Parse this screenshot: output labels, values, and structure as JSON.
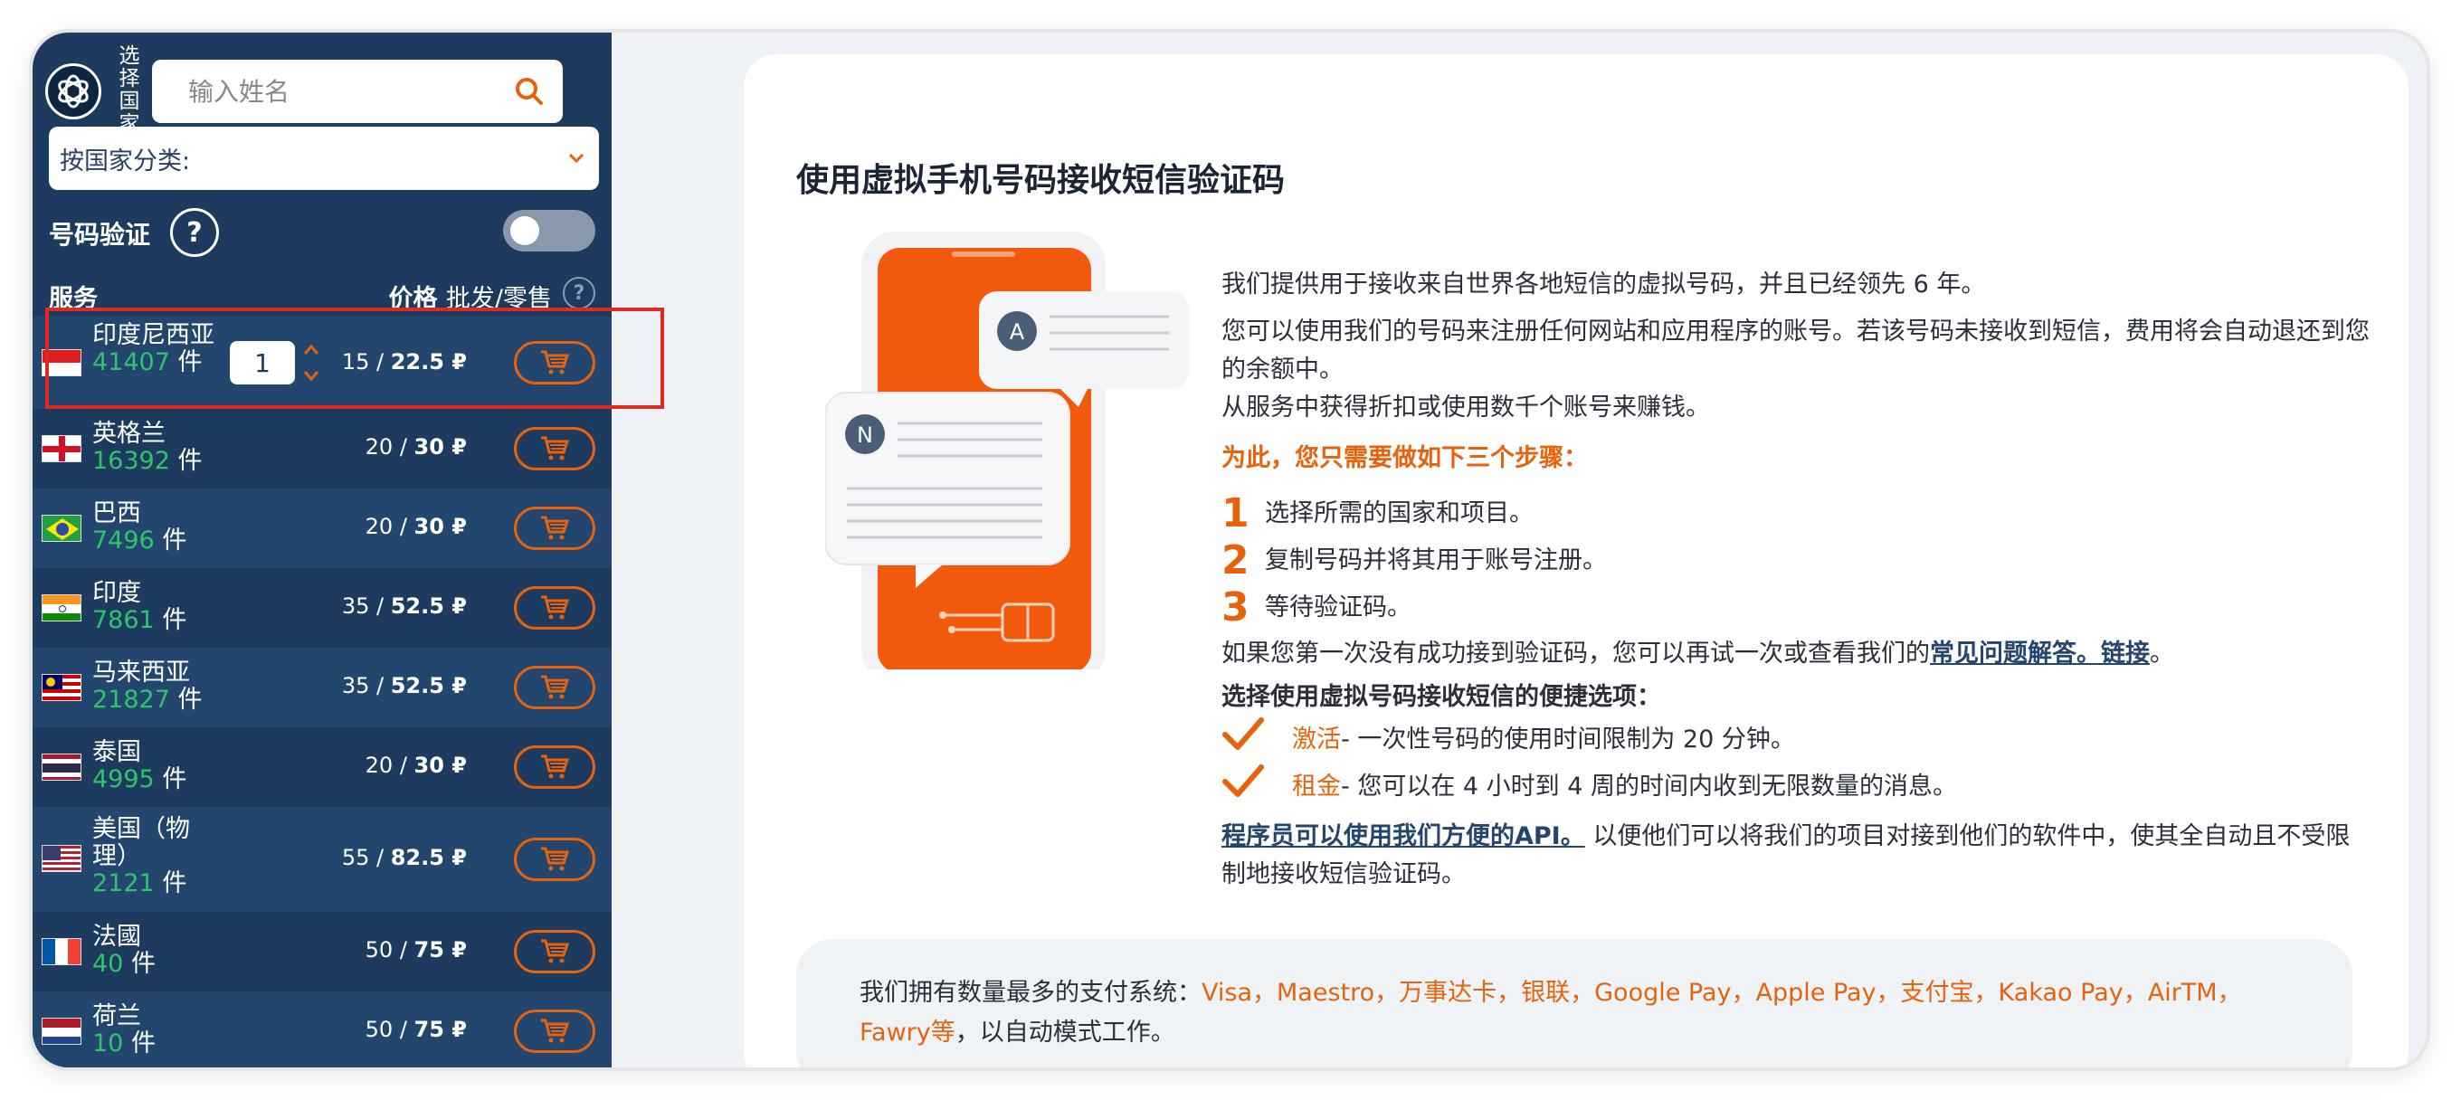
{
  "sidebar": {
    "vertical_label": "选择国家",
    "search_placeholder": "输入姓名",
    "country_filter": "按国家分类:",
    "verify_label": "号码验证",
    "help_label": "?",
    "col_service": "服务",
    "col_price": "价格",
    "col_price_sub": "批发/零售",
    "col_q": "?",
    "count_unit": "件",
    "rows": [
      {
        "name": "印度尼西亚",
        "count": "41407",
        "price": "15 / ",
        "price_bold": "22.5 ₽",
        "qty": "1"
      },
      {
        "name": "英格兰",
        "count": "16392",
        "price": "20 / ",
        "price_bold": "30 ₽"
      },
      {
        "name": "巴西",
        "count": "7496",
        "price": "20 / ",
        "price_bold": "30 ₽"
      },
      {
        "name": "印度",
        "count": "7861",
        "price": "35 / ",
        "price_bold": "52.5 ₽"
      },
      {
        "name": "马来西亚",
        "count": "21827",
        "price": "35 / ",
        "price_bold": "52.5 ₽"
      },
      {
        "name": "泰国",
        "count": "4995",
        "price": "20 / ",
        "price_bold": "30 ₽"
      },
      {
        "name": "美国（物理）",
        "count": "2121",
        "price": "55 / ",
        "price_bold": "82.5 ₽"
      },
      {
        "name": "法國",
        "count": "40",
        "price": "50 / ",
        "price_bold": "75 ₽"
      },
      {
        "name": "荷兰",
        "count": "10",
        "price": "50 / ",
        "price_bold": "75 ₽"
      }
    ]
  },
  "main": {
    "title": "使用虚拟手机号码接收短信验证码",
    "para1": "我们提供用于接收来自世界各地短信的虚拟号码，并且已经领先 6 年。",
    "para2": "您可以使用我们的号码来注册任何网站和应用程序的账号。若该号码未接收到短信，费用将会自动退还到您的余额中。",
    "para3": "从服务中获得折扣或使用数千个账号来赚钱。",
    "steps_head": "为此，您只需要做如下三个步骤：",
    "steps": [
      {
        "n": "1",
        "text": "选择所需的国家和项目。"
      },
      {
        "n": "2",
        "text": "复制号码并将其用于账号注册。"
      },
      {
        "n": "3",
        "text": "等待验证码。"
      }
    ],
    "retry_text": "如果您第一次没有成功接到验证码，您可以再试一次或查看我们的",
    "faq_link": "常见问题解答。链接",
    "retry_end": "。",
    "options_head": "选择使用虚拟号码接收短信的便捷选项：",
    "opt1_kw": "激活",
    "opt1_text": " - 一次性号码的使用时间限制为 20 分钟。",
    "opt2_kw": "租金",
    "opt2_text": " - 您可以在 4 小时到 4 周的时间内收到无限数量的消息。",
    "api_link": "程序员可以使用我们方便的API。",
    "api_text": "以便他们可以将我们的项目对接到他们的软件中，使其全自动且不受限制地接收短信验证码。",
    "illus_badge_a": "A",
    "illus_badge_n": "N"
  },
  "payments": {
    "lead": "我们拥有数量最多的支付系统：",
    "list": "Visa，Maestro，万事达卡，银联，Google Pay，Apple Pay，支付宝，Kakao Pay，AirTM，",
    "list2": "Fawry等",
    "tail": "，以自动模式工作。"
  },
  "colors": {
    "sidebar_bg": "#1d3b5e",
    "accent": "#e8620c",
    "count_green": "#2fc46a",
    "highlight_red": "#e02a1f"
  }
}
